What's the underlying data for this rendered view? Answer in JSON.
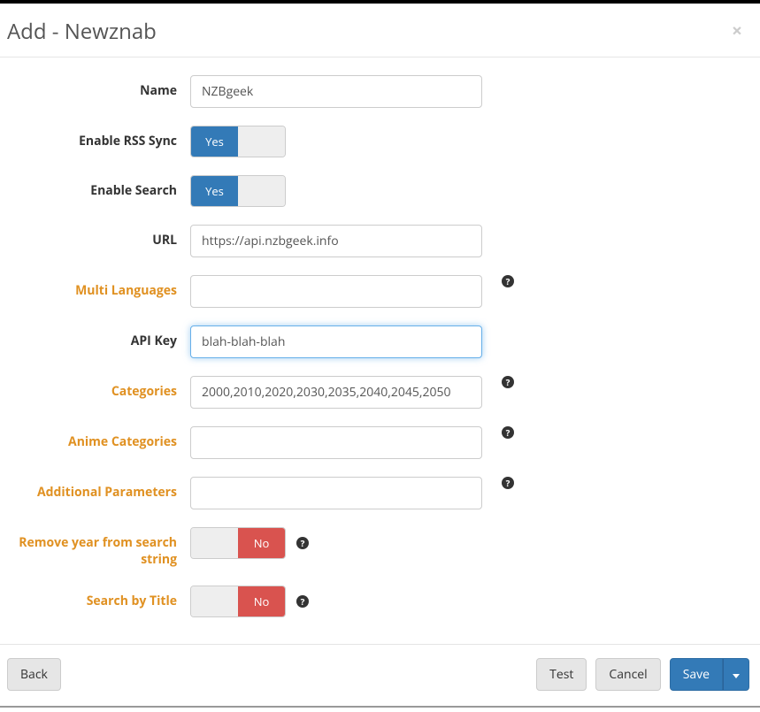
{
  "header": {
    "title": "Add - Newznab",
    "close_glyph": "×"
  },
  "labels": {
    "name": "Name",
    "enable_rss": "Enable RSS Sync",
    "enable_search": "Enable Search",
    "url": "URL",
    "multi_languages": "Multi Languages",
    "api_key": "API Key",
    "categories": "Categories",
    "anime_categories": "Anime Categories",
    "additional_parameters": "Additional Parameters",
    "remove_year": "Remove year from search string",
    "search_by_title": "Search by Title"
  },
  "values": {
    "name": "NZBgeek",
    "enable_rss": "Yes",
    "enable_search": "Yes",
    "url": "https://api.nzbgeek.info",
    "multi_languages": "",
    "api_key": "blah-blah-blah",
    "categories": "2000,2010,2020,2030,2035,2040,2045,2050",
    "anime_categories": "",
    "additional_parameters": "",
    "remove_year": "No",
    "search_by_title": "No"
  },
  "footer": {
    "back": "Back",
    "test": "Test",
    "cancel": "Cancel",
    "save": "Save"
  },
  "help_glyph": "?"
}
